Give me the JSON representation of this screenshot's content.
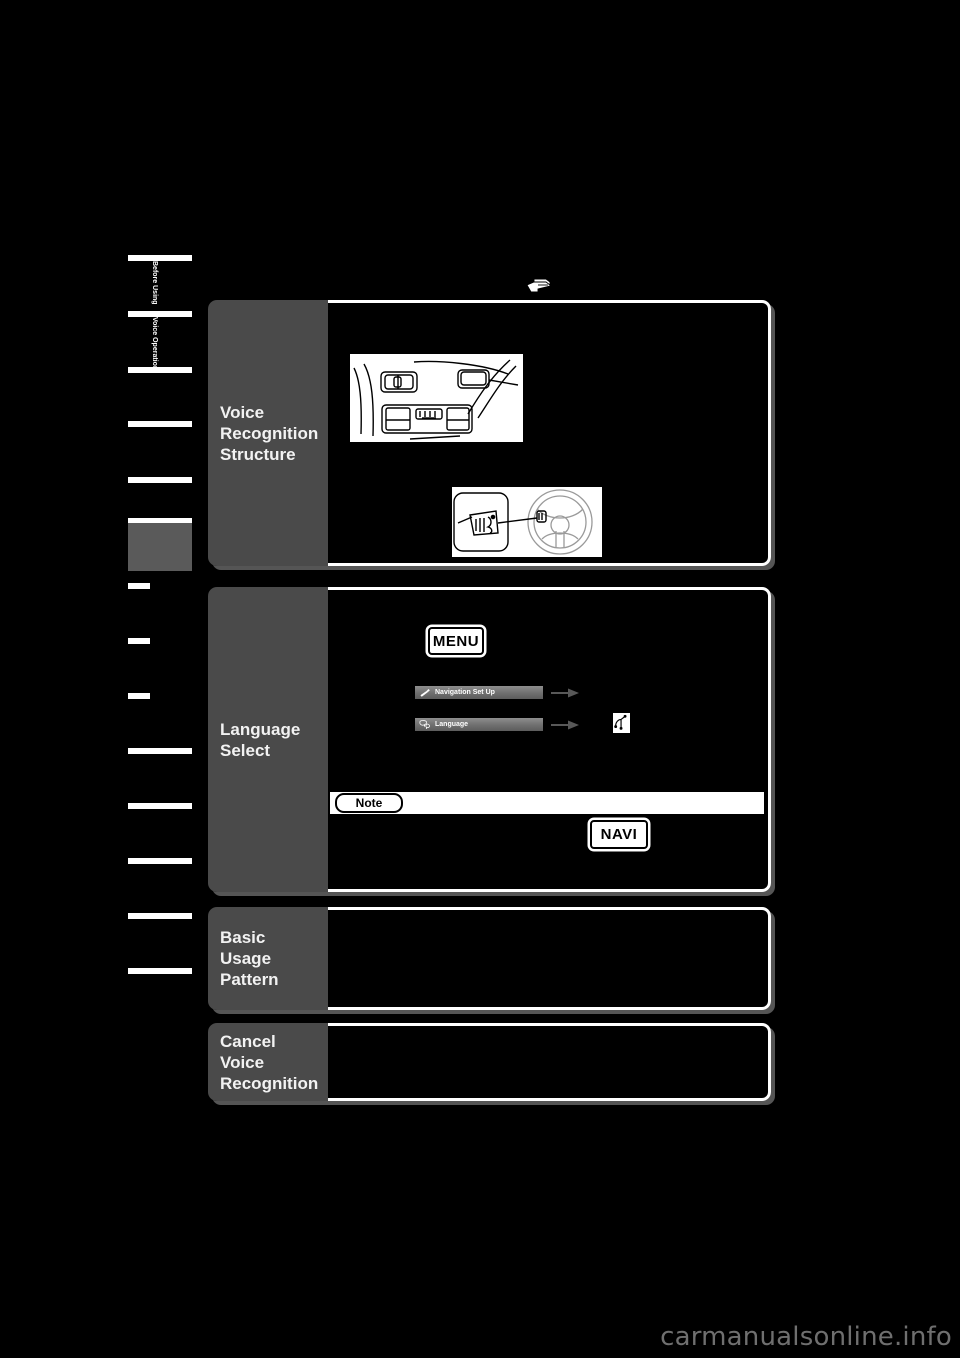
{
  "page": {
    "background_color": "#000000",
    "panel_label_color": "#4a4a4a",
    "accent_color": "#ffffff",
    "watermark": "carmanualsonline.info"
  },
  "index_tabs": [
    {
      "label": "Before Using",
      "active": false
    },
    {
      "label": "Voice Operation",
      "active": false
    },
    {
      "label": "",
      "active": false
    },
    {
      "label": "",
      "active": false
    },
    {
      "label": "",
      "active": true
    },
    {
      "label": "",
      "active": false
    },
    {
      "label": "",
      "active": false
    },
    {
      "label": "",
      "active": false
    },
    {
      "label": "",
      "active": false
    },
    {
      "label": "",
      "active": false
    },
    {
      "label": "",
      "active": false
    }
  ],
  "sections": [
    {
      "id": "structure",
      "title": "Voice\nRecognition\nStructure",
      "title_lines": [
        "Voice",
        "Recognition",
        "Structure"
      ],
      "illustrations": [
        "overhead-console-microphone",
        "steering-wheel-talk-switch"
      ],
      "marker_icon": "pointing-hand-icon"
    },
    {
      "id": "language",
      "title_lines": [
        "Language",
        "Select"
      ],
      "hardkey": "MENU",
      "menu_rows": [
        {
          "icon": "wrench-icon",
          "label": "Navigation Set Up"
        },
        {
          "icon": "speech-icon",
          "label": "Language"
        }
      ],
      "result_icon": "voice-language-icon",
      "note": {
        "label": "Note",
        "hardkey": "NAVI"
      }
    },
    {
      "id": "basic",
      "title_lines": [
        "Basic",
        "Usage",
        "Pattern"
      ]
    },
    {
      "id": "cancel",
      "title_lines": [
        "Cancel",
        "Voice",
        "Recognition"
      ]
    }
  ],
  "buttons": {
    "menu": "MENU",
    "navi": "NAVI",
    "note": "Note"
  },
  "menu_labels": {
    "navigation_set_up": "Navigation Set Up",
    "language": "Language"
  }
}
